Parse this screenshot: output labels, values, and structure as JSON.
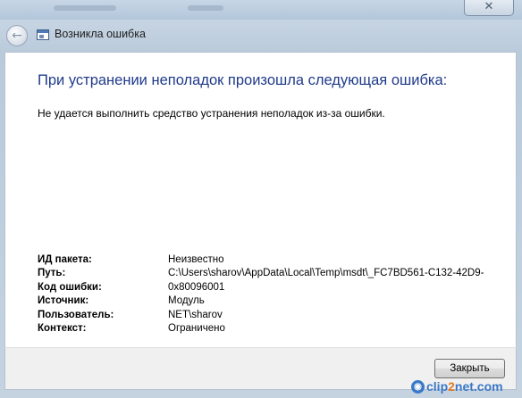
{
  "window": {
    "close_glyph": "✕"
  },
  "nav": {
    "back_glyph": "←",
    "icon": "window-icon",
    "title": "Возникла ошибка"
  },
  "main": {
    "heading": "При устранении неполадок произошла следующая ошибка:",
    "message": "Не удается выполнить средство устранения неполадок из-за ошибки.",
    "details": [
      {
        "label": "ИД пакета:",
        "value": "Неизвестно"
      },
      {
        "label": "Путь:",
        "value": "C:\\Users\\sharov\\AppData\\Local\\Temp\\msdt\\_FC7BD561-C132-42D9-"
      },
      {
        "label": "Код ошибки:",
        "value": "0x80096001"
      },
      {
        "label": "Источник:",
        "value": "Модуль"
      },
      {
        "label": "Пользователь:",
        "value": "NET\\sharov"
      },
      {
        "label": "Контекст:",
        "value": "Ограничено"
      }
    ]
  },
  "footer": {
    "close_button_label": "Закрыть"
  },
  "watermark": {
    "pre": "clip",
    "mid": "2",
    "post": "net.com"
  },
  "colors": {
    "heading": "#1f3a8a",
    "watermark_blue": "#3a78c8",
    "watermark_orange": "#e07a1f"
  }
}
